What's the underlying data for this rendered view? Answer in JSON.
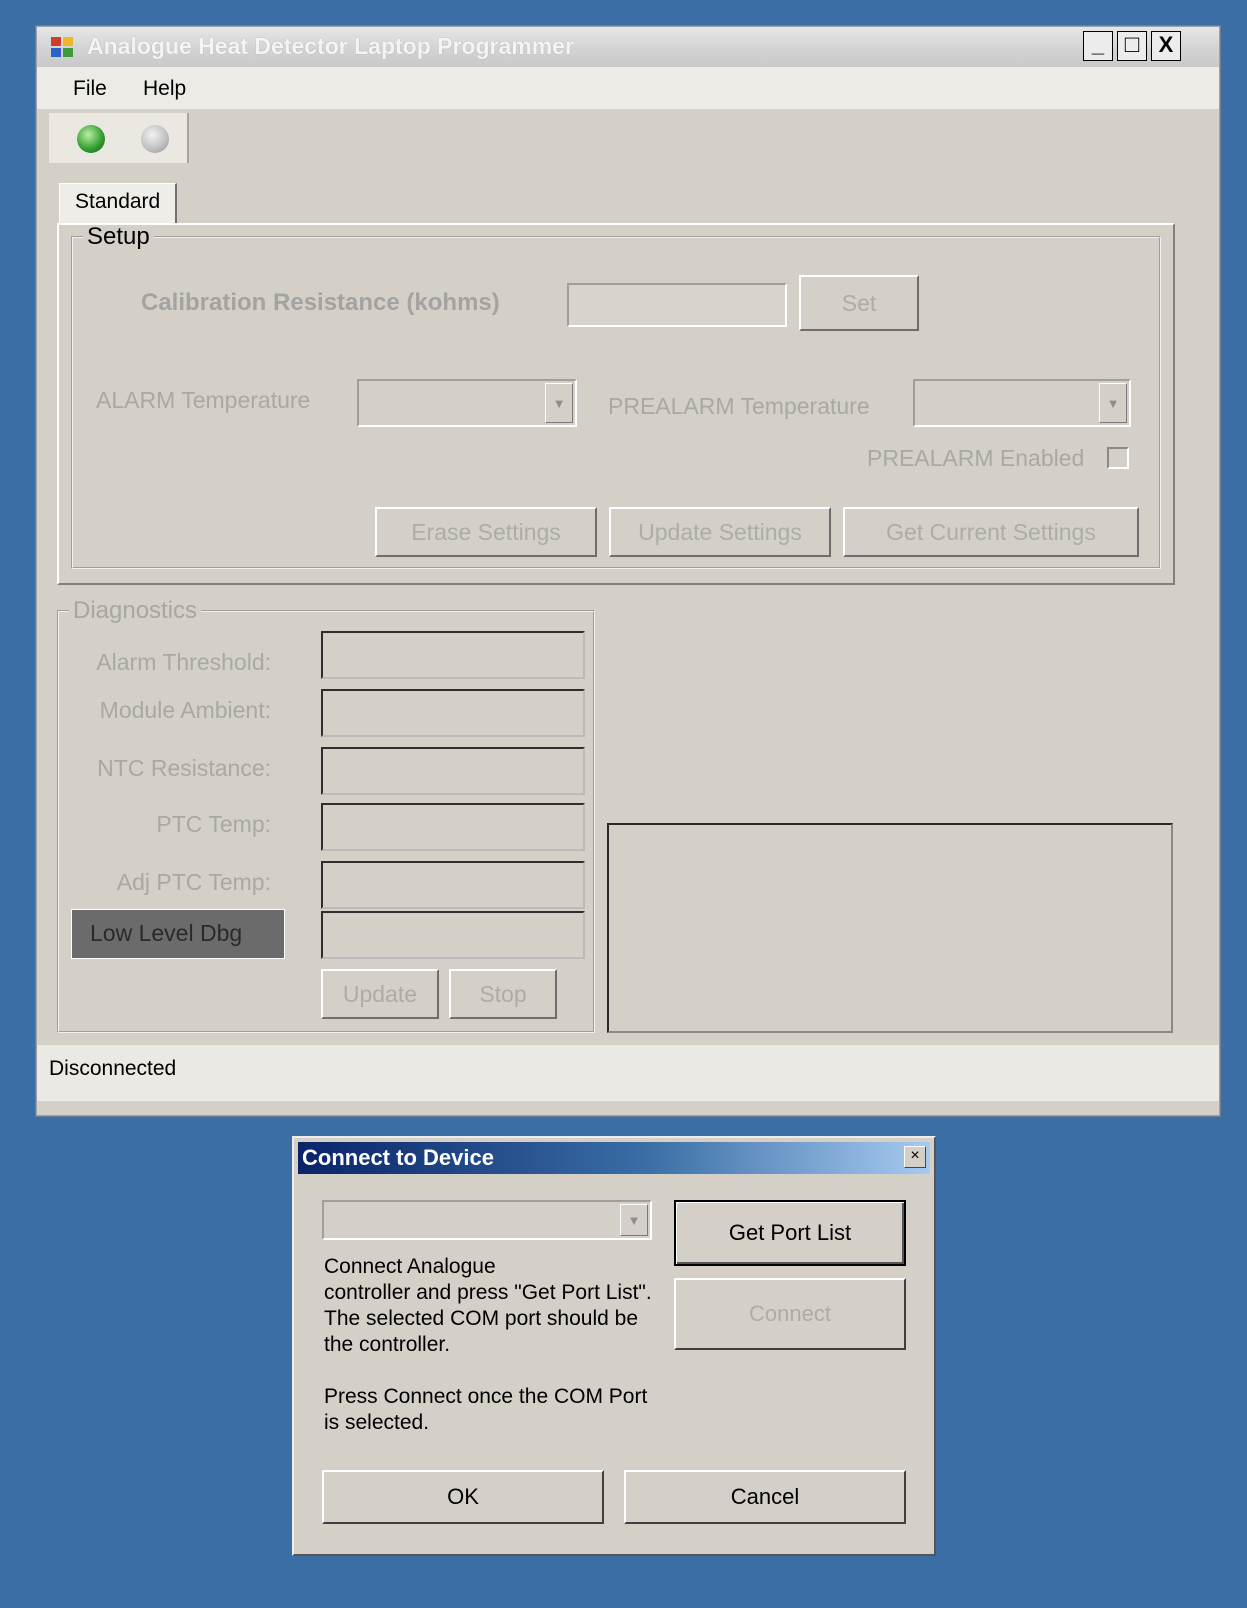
{
  "main_window": {
    "title": "Analogue Heat Detector Laptop Programmer",
    "controls": {
      "minimize": "_",
      "maximize": "□",
      "close": "X"
    },
    "menu": [
      "File",
      "Help"
    ],
    "toolbar_icons": [
      "connect-icon",
      "disconnect-icon"
    ],
    "tabs": [
      "Standard"
    ],
    "setup": {
      "legend": "Setup",
      "calibration_label": "Calibration Resistance (kohms)",
      "calibration_value": "",
      "set_button": "Set",
      "alarm_temp_label": "ALARM Temperature",
      "alarm_temp_value": "",
      "prealarm_temp_label": "PREALARM Temperature",
      "prealarm_temp_value": "",
      "prealarm_enabled_label": "PREALARM Enabled",
      "prealarm_enabled": false,
      "erase_button": "Erase Settings",
      "update_button": "Update Settings",
      "get_current_button": "Get Current Settings"
    },
    "diagnostics": {
      "legend": "Diagnostics",
      "fields": [
        {
          "label": "Alarm Threshold:",
          "value": ""
        },
        {
          "label": "Module Ambient:",
          "value": ""
        },
        {
          "label": "NTC Resistance:",
          "value": ""
        },
        {
          "label": "PTC Temp:",
          "value": ""
        },
        {
          "label": "Adj PTC Temp:",
          "value": ""
        },
        {
          "label": "Low Level Dbg",
          "value": ""
        }
      ],
      "update_button": "Update",
      "stop_button": "Stop"
    },
    "status": "Disconnected"
  },
  "dialog": {
    "title": "Connect to Device",
    "close": "×",
    "port_value": "",
    "get_port_list_button": "Get Port List",
    "connect_button": "Connect",
    "instructions_lines": [
      "Connect Analogue",
      "controller and press \"Get Port List\".",
      "The selected COM port should be",
      "the controller."
    ],
    "instructions2_lines": [
      "Press Connect once the COM Port",
      "is selected."
    ],
    "ok_button": "OK",
    "cancel_button": "Cancel"
  },
  "colors": {
    "desktop": "#3a6ea5",
    "window_face": "#d4d0c8",
    "disabled_text": "#a8a8a4",
    "dialog_title_start": "#0a246a"
  }
}
